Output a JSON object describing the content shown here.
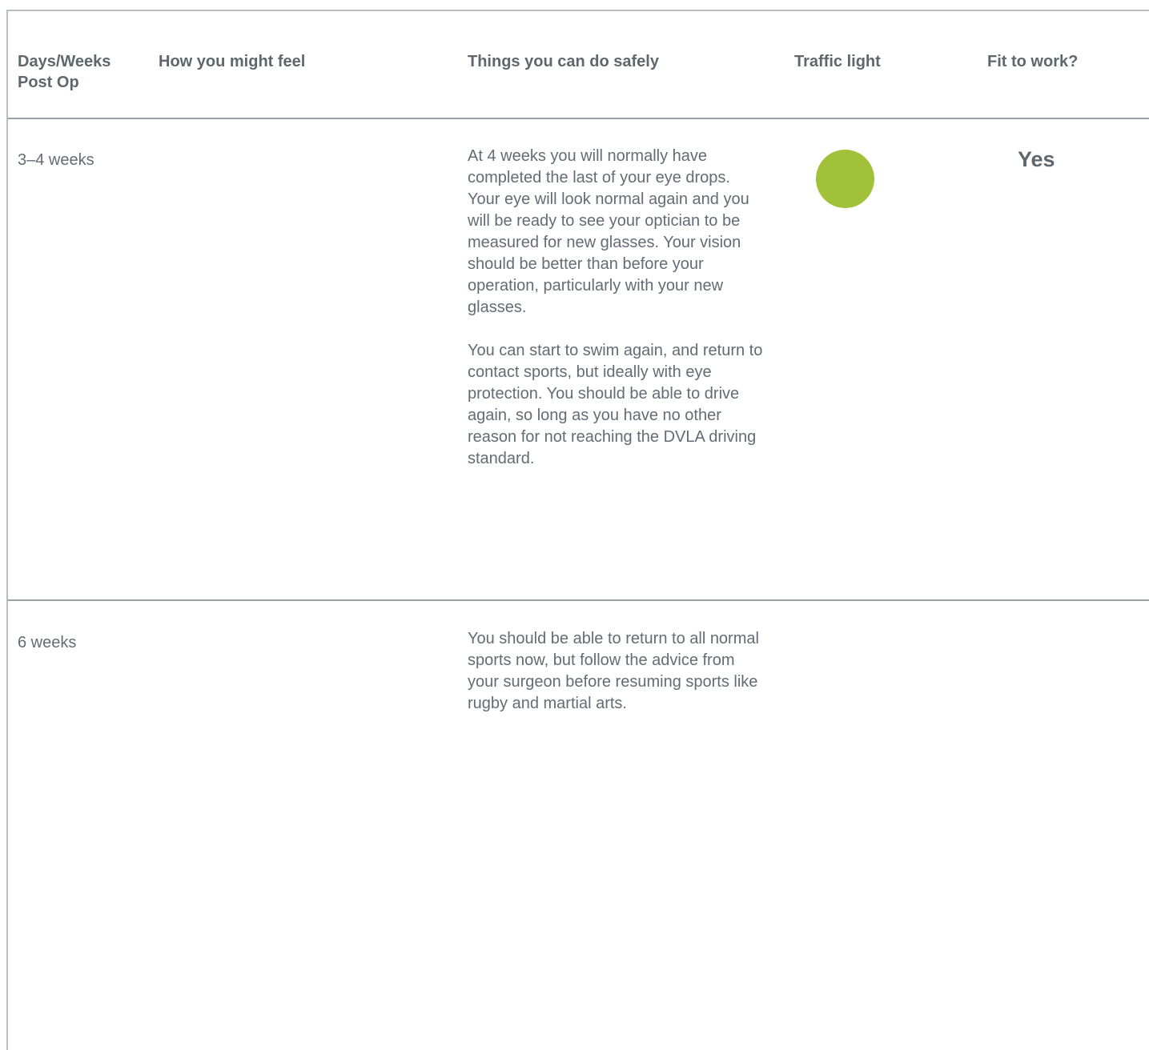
{
  "table": {
    "headers": {
      "days": "Days/Weeks Post Op",
      "feel": "How you might feel",
      "safe": "Things you can do safely",
      "traffic": "Traffic light",
      "fit": "Fit to work?"
    },
    "rows": [
      {
        "days": "3–4 weeks",
        "feel": "",
        "safe": [
          "At 4 weeks you will normally have completed the last of your eye drops. Your eye will look normal again and you will be ready to see your optician to be measured for new glasses. Your vision should be better than before your operation, particularly with your new glasses.",
          "You can start to swim again, and return to contact sports, but ideally with eye protection. You should be able to drive again, so long as you have no other reason for not reaching the DVLA driving standard."
        ],
        "traffic_light_color": "#a2c13a",
        "fit": "Yes"
      },
      {
        "days": "6 weeks",
        "feel": "",
        "safe": [
          "You should be able to return to all normal sports now, but follow the advice from your surgeon before resuming sports like rugby and martial arts."
        ],
        "traffic_light_color": "",
        "fit": ""
      }
    ]
  }
}
